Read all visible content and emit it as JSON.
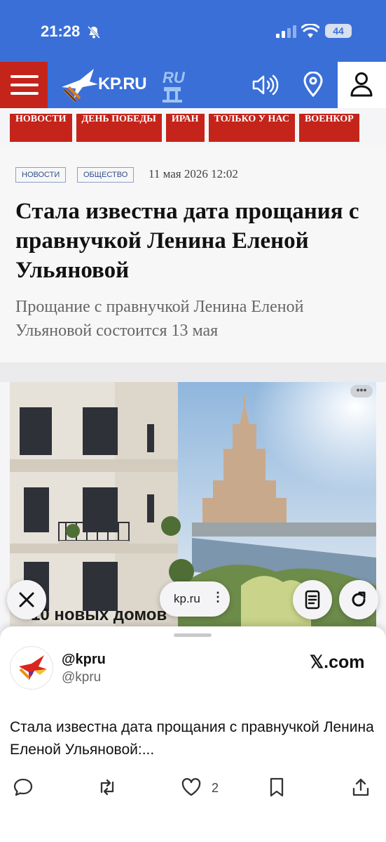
{
  "status_bar": {
    "time": "21:28",
    "battery": "44"
  },
  "header": {
    "logo_text": "KP.RU",
    "logo_badge": "RU"
  },
  "nav": {
    "tabs": [
      "НОВОСТИ",
      "ДЕНЬ ПОБЕДЫ",
      "ИРАН",
      "ТОЛЬКО У НАС",
      "ВОЕНКОР"
    ]
  },
  "article": {
    "tags": [
      "НОВОСТИ",
      "ОБЩЕСТВО"
    ],
    "date": "11 мая 2026 12:02",
    "title": "Стала известна дата прощания с правнучкой Ленина Еленой Ульяновой",
    "subtitle": "Прощание с правнучкой Ленина Еленой Ульяновой состоится 13 мая"
  },
  "ad": {
    "caption": "10 новых домов",
    "more": "•••"
  },
  "browser": {
    "url": "kp.ru",
    "menu": "⋮"
  },
  "tweet": {
    "name": "@kpru",
    "handle": "@kpru",
    "source": "𝕏.com",
    "text": "Стала известна дата прощания с правнучкой Ленина Еленой Ульяновой:...",
    "like_count": "2"
  },
  "icons": {
    "bell": "bell-slash-icon",
    "signal": "signal-icon",
    "wifi": "wifi-icon",
    "menu": "hamburger-icon",
    "sound": "speaker-icon",
    "location": "location-pin-icon",
    "user": "user-icon",
    "close": "close-icon",
    "reader": "reader-icon",
    "reload": "reload-icon",
    "reply": "reply-icon",
    "retweet": "retweet-icon",
    "like": "heart-icon",
    "bookmark": "bookmark-icon",
    "share": "share-icon"
  },
  "colors": {
    "brand_blue": "#3a6fd8",
    "brand_red": "#c4241a",
    "tag_text": "#2f4f86"
  }
}
